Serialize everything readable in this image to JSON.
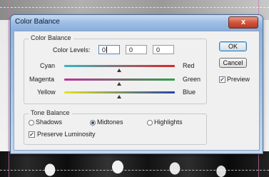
{
  "window": {
    "title": "Color Balance",
    "close_label": "x"
  },
  "color_balance": {
    "group_label": "Color Balance",
    "levels_label": "Color Levels:",
    "levels": [
      "0",
      "0",
      "0"
    ],
    "sliders": [
      {
        "left": "Cyan",
        "right": "Red",
        "value": 0
      },
      {
        "left": "Magenta",
        "right": "Green",
        "value": 0
      },
      {
        "left": "Yellow",
        "right": "Blue",
        "value": 0
      }
    ]
  },
  "tone_balance": {
    "group_label": "Tone Balance",
    "options": [
      "Shadows",
      "Midtones",
      "Highlights"
    ],
    "selected": "Midtones",
    "preserve_luminosity_label": "Preserve Luminosity",
    "preserve_luminosity": true
  },
  "buttons": {
    "ok": "OK",
    "cancel": "Cancel"
  },
  "preview": {
    "label": "Preview",
    "checked": true
  },
  "colors": {
    "cyan_red": [
      "#37b6c4",
      "#d8252c"
    ],
    "magenta_green": [
      "#c0309a",
      "#2ea04a"
    ],
    "yellow_blue": [
      "#e6e31c",
      "#2446a8"
    ]
  }
}
